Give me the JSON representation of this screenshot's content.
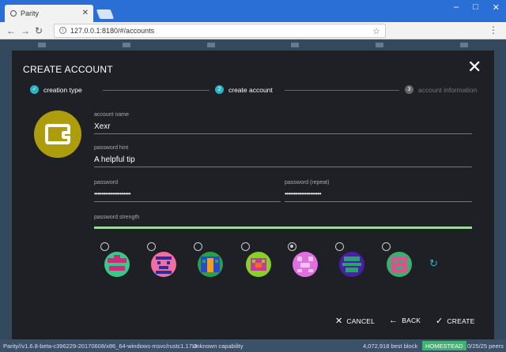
{
  "browser": {
    "tab_title": "Parity",
    "url": "127.0.0.1:8180/#/accounts"
  },
  "modal": {
    "title": "CREATE ACCOUNT",
    "steps": [
      {
        "number": "1",
        "label": "creation type",
        "state": "done"
      },
      {
        "number": "2",
        "label": "create account",
        "state": "active"
      },
      {
        "number": "3",
        "label": "account information",
        "state": "pending"
      }
    ],
    "fields": {
      "account_name": {
        "label": "account name",
        "value": "Xexr"
      },
      "password_hint": {
        "label": "password hint",
        "value": "A helpful tip"
      },
      "password": {
        "label": "password",
        "value": "••••••••••••••••••••"
      },
      "password_repeat": {
        "label": "password (repeat)",
        "value": "••••••••••••••••••••"
      },
      "password_strength": {
        "label": "password strength",
        "level": 1.0
      }
    },
    "identicons": [
      {
        "selected": false
      },
      {
        "selected": false
      },
      {
        "selected": false
      },
      {
        "selected": false
      },
      {
        "selected": true
      },
      {
        "selected": false
      },
      {
        "selected": false
      }
    ],
    "actions": {
      "cancel": "CANCEL",
      "back": "BACK",
      "create": "CREATE"
    },
    "colors": {
      "accent": "#2ab3c4",
      "strength": "#8fe388",
      "avatar": "#ad9d0d"
    }
  },
  "statusbar": {
    "version": "Parity//v1.6.8-beta-c396229-20170608/x86_64-windows-msvc/rustc1.17.0",
    "capability": "Unknown capability",
    "best_block": "4,072,918 best block",
    "network": "HOMESTEAD",
    "peers": "0/25/25 peers"
  }
}
